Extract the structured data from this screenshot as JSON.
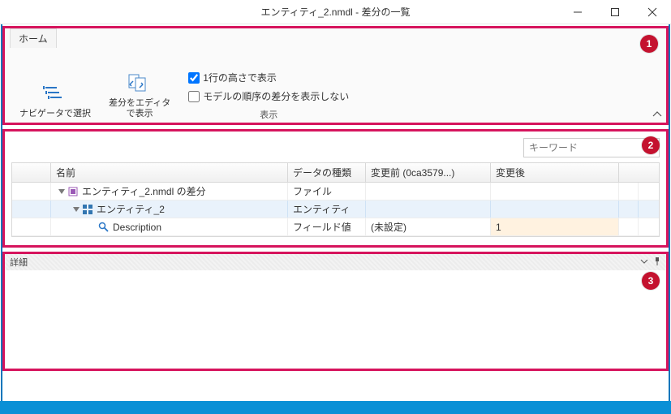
{
  "window": {
    "title": "エンティティ_2.nmdl - 差分の一覧"
  },
  "ribbon": {
    "tab_home": "ホーム",
    "btn_navigator": "ナビゲータで選択",
    "btn_editor": "差分をエディタ\nで表示",
    "chk_single_line": "1行の高さで表示",
    "chk_hide_order": "モデルの順序の差分を表示しない",
    "group_view": "表示"
  },
  "search": {
    "placeholder": "キーワード"
  },
  "grid": {
    "col_name": "名前",
    "col_type": "データの種類",
    "col_before": "変更前 (0ca3579...)",
    "col_after": "変更後",
    "rows": [
      {
        "name": "エンティティ_2.nmdl の差分",
        "type": "ファイル",
        "before": "",
        "after": ""
      },
      {
        "name": "エンティティ_2",
        "type": "エンティティ",
        "before": "",
        "after": ""
      },
      {
        "name": "Description",
        "type": "フィールド値",
        "before": "(未設定)",
        "after": "1"
      }
    ]
  },
  "detail": {
    "title": "詳細"
  },
  "badges": {
    "b1": "1",
    "b2": "2",
    "b3": "3"
  }
}
